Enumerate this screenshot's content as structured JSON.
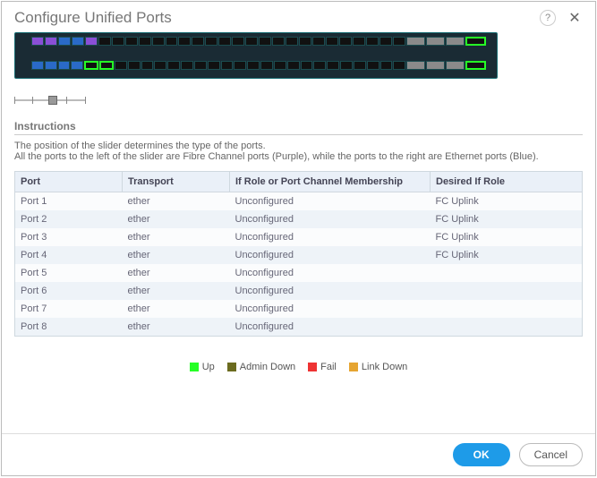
{
  "header": {
    "title": "Configure Unified Ports",
    "help_label": "?"
  },
  "instructions": {
    "heading": "Instructions",
    "line1": "The position of the slider determines the type of the ports.",
    "line2": "All the ports to the left of the slider are Fibre Channel ports (Purple), while the ports to the right are Ethernet ports (Blue)."
  },
  "table": {
    "columns": [
      "Port",
      "Transport",
      "If Role or Port Channel Membership",
      "Desired If Role"
    ],
    "rows": [
      {
        "port": "Port 1",
        "transport": "ether",
        "role": "Unconfigured",
        "desired": "FC Uplink"
      },
      {
        "port": "Port 2",
        "transport": "ether",
        "role": "Unconfigured",
        "desired": "FC Uplink"
      },
      {
        "port": "Port 3",
        "transport": "ether",
        "role": "Unconfigured",
        "desired": "FC Uplink"
      },
      {
        "port": "Port 4",
        "transport": "ether",
        "role": "Unconfigured",
        "desired": "FC Uplink"
      },
      {
        "port": "Port 5",
        "transport": "ether",
        "role": "Unconfigured",
        "desired": ""
      },
      {
        "port": "Port 6",
        "transport": "ether",
        "role": "Unconfigured",
        "desired": ""
      },
      {
        "port": "Port 7",
        "transport": "ether",
        "role": "Unconfigured",
        "desired": ""
      },
      {
        "port": "Port 8",
        "transport": "ether",
        "role": "Unconfigured",
        "desired": ""
      }
    ]
  },
  "legend": {
    "up": "Up",
    "admin_down": "Admin Down",
    "fail": "Fail",
    "link_down": "Link Down"
  },
  "footer": {
    "ok": "OK",
    "cancel": "Cancel"
  }
}
